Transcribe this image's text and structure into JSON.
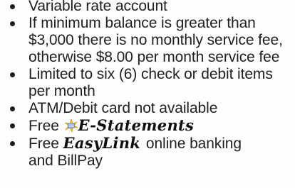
{
  "features": {
    "item1": "Variable rate account",
    "item2": {
      "line1": "If minimum balance is greater than",
      "line2": "$3,000 there is no monthly service fee,",
      "line3": "otherwise $8.00 per month service fee"
    },
    "item3": {
      "line1": "Limited to six (6) check or debit items",
      "line2": "per month"
    },
    "item4": "ATM/Debit card not available",
    "item5": {
      "prefix": "Free",
      "brand": "E-Statements"
    },
    "item6": {
      "prefix": "Free",
      "brand": "EasyLink",
      "suffix": "online banking",
      "line2": "and BillPay"
    }
  },
  "colors": {
    "text": "#1f1f1f",
    "background": "#fefefe",
    "estatement_icon_primary": "#f2c21b",
    "estatement_icon_secondary": "#3a6fd8"
  },
  "icons": {
    "estatements_logo": "e-statements-sunburst-icon"
  }
}
